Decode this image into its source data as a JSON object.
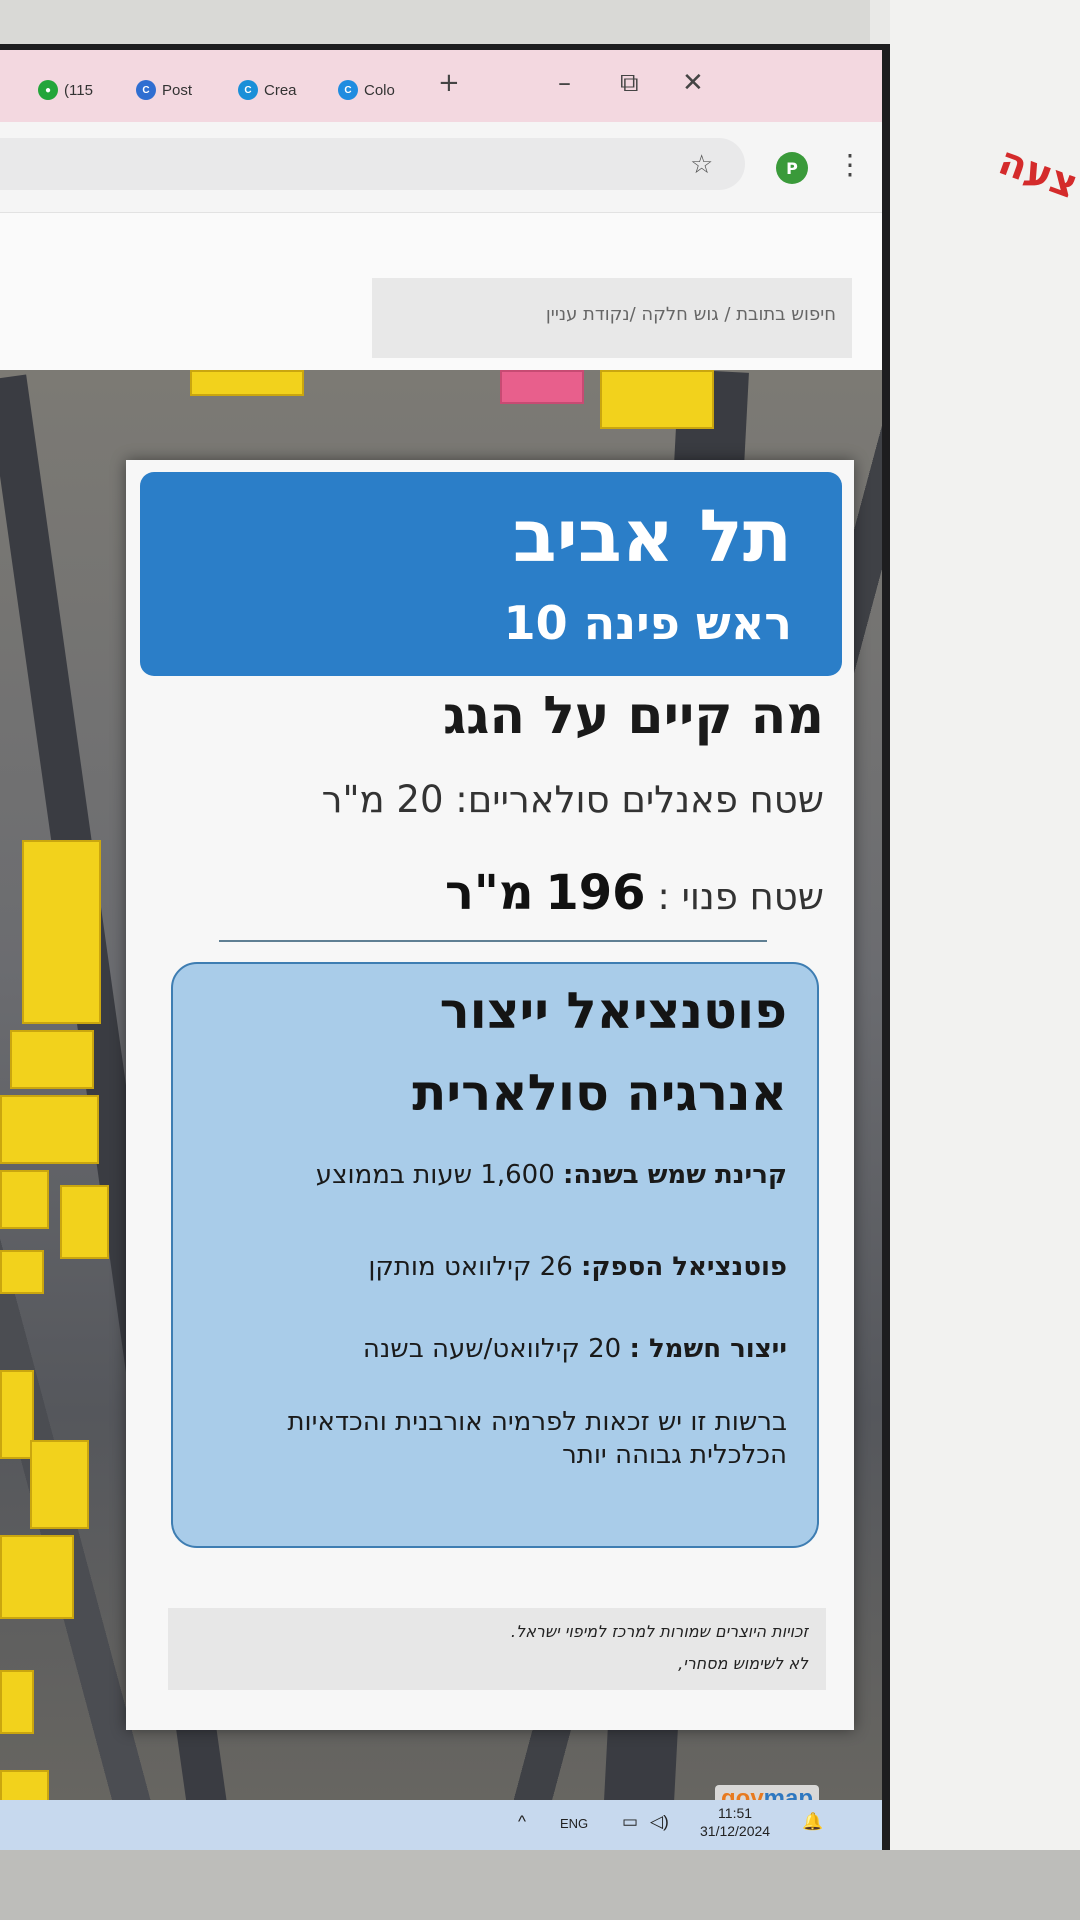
{
  "browser": {
    "tabs": [
      {
        "label": "(115",
        "color": "#23a53a"
      },
      {
        "label": "Post",
        "color": "#2f6ed1"
      },
      {
        "label": "Crea",
        "color": "#1a8fd8"
      },
      {
        "label": "Colo",
        "color": "#1f8ce0"
      }
    ],
    "new_tab": "+",
    "minimize": "–",
    "restore": "⧉",
    "close": "✕",
    "star": "☆",
    "profile_letter": "P",
    "menu": "⋮"
  },
  "breadcrumb": "חיפוש בתובת / גוש חלקה /נקודת עניין",
  "popup": {
    "city": "תל אביב",
    "street": "ראש פינה 10",
    "section_title": "מה קיים על הגג",
    "solar_area_label": "שטח פאנלים סולאריים: 20 מ\"ר",
    "free_area_label": "שטח פנוי :",
    "free_area_value": "196",
    "free_area_unit": "מ\"ר",
    "potential_title_1": "פוטנציאל ייצור",
    "potential_title_2": "אנרגיה סולארית",
    "sun_label": "קרינת שמש בשנה:",
    "sun_value": "1,600 שעות בממוצע",
    "supply_label": "פוטנציאל הספק:",
    "supply_value": "26 קילוואט מותקן",
    "production_label": "ייצור חשמל :",
    "production_value": "20 קילוואט/שעה בשנה",
    "note": "ברשות זו יש זכאות לפרמיה אורבנית והכדאיות הכלכלית גבוהה יותר",
    "footer_1": "זכויות היוצרים שמורות למרכז למיפוי ישראל.",
    "footer_2": "לא לשימוש מסחרי,"
  },
  "map_logo": {
    "prefix": "gov",
    "suffix": "map"
  },
  "taskbar": {
    "chevron": "^",
    "lang": "ENG",
    "time": "11:51",
    "date": "31/12/2024"
  },
  "bezel_text": "צעה",
  "colors": {
    "header_blue": "#2b7ec8",
    "potential_bg": "#a9cce9",
    "roof_yellow": "#f2d21c"
  }
}
